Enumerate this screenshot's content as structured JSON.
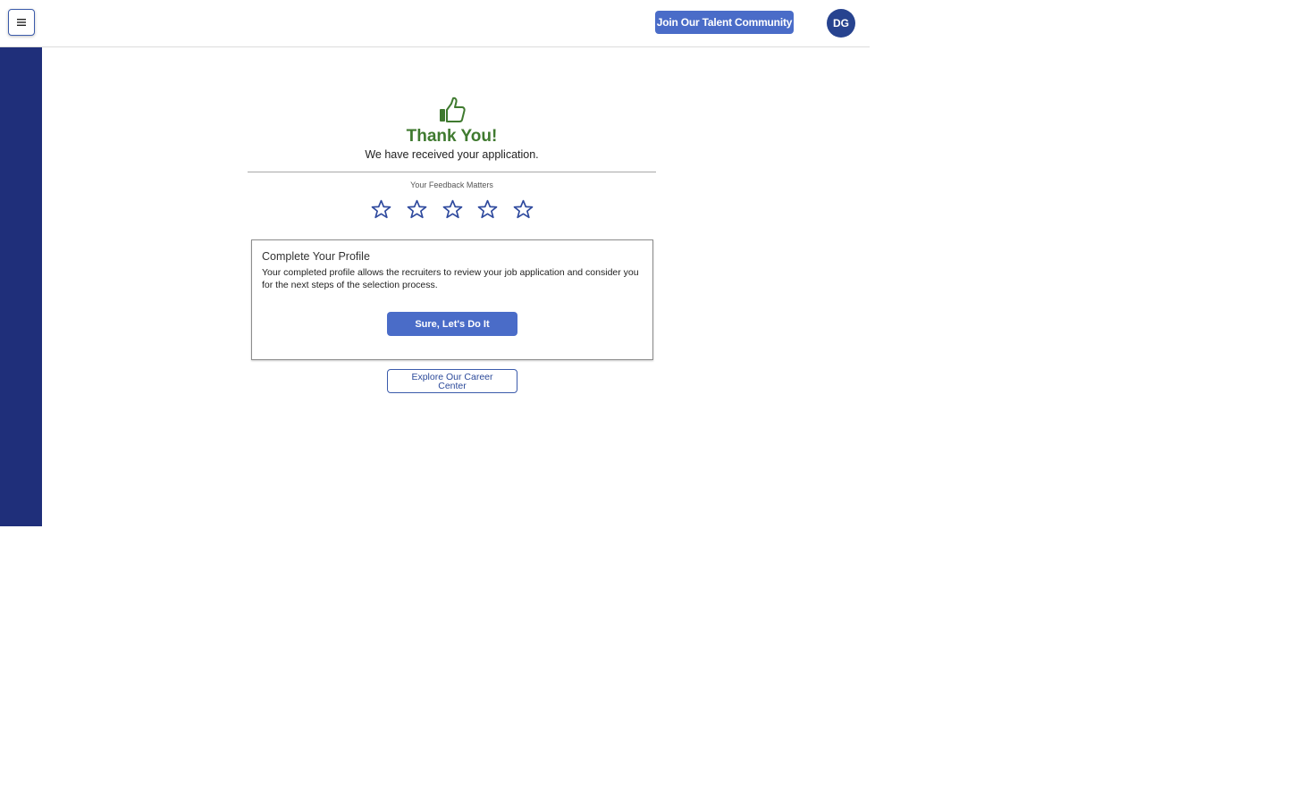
{
  "header": {
    "menu_icon": "hamburger-menu-icon",
    "talent_button_label": "Join Our Talent Community",
    "avatar_initials": "DG"
  },
  "colors": {
    "accent_blue": "#4a6cc8",
    "sidebar_navy": "#1f2f7a",
    "avatar_navy": "#27438f",
    "success_green": "#3f7a2f",
    "star_outline": "#2f4a9e"
  },
  "confirmation": {
    "icon": "thumbs-up-icon",
    "title": "Thank You!",
    "message": "We have received your application."
  },
  "feedback": {
    "label": "Your Feedback Matters",
    "star_icon": "star-outline-icon",
    "max_rating": 5,
    "current_rating": 0
  },
  "profile_card": {
    "title": "Complete Your Profile",
    "description": "Your completed profile allows the recruiters to review your job application and consider you for the next steps of the selection process.",
    "button_label": "Sure, Let's Do It"
  },
  "career_center": {
    "button_label": "Explore Our Career Center"
  }
}
